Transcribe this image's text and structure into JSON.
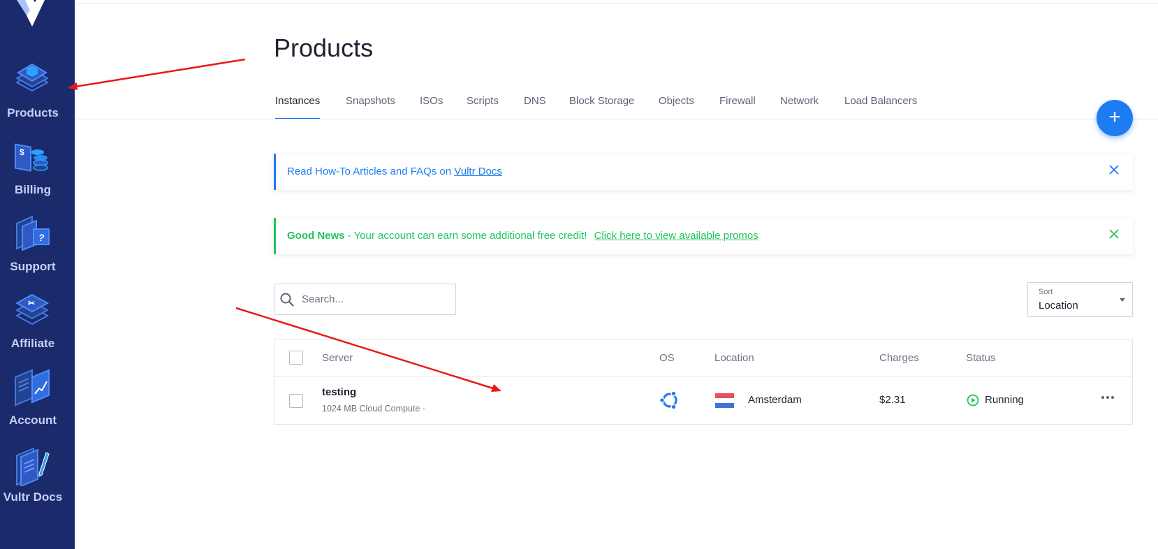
{
  "sidebar": {
    "items": [
      {
        "label": "Products",
        "icon": "products-icon"
      },
      {
        "label": "Billing",
        "icon": "billing-icon"
      },
      {
        "label": "Support",
        "icon": "support-icon"
      },
      {
        "label": "Affiliate",
        "icon": "affiliate-icon"
      },
      {
        "label": "Account",
        "icon": "account-icon"
      },
      {
        "label": "Vultr Docs",
        "icon": "docs-icon"
      }
    ]
  },
  "page": {
    "title": "Products"
  },
  "tabs": [
    {
      "label": "Instances",
      "active": true
    },
    {
      "label": "Snapshots",
      "active": false
    },
    {
      "label": "ISOs",
      "active": false
    },
    {
      "label": "Scripts",
      "active": false
    },
    {
      "label": "DNS",
      "active": false
    },
    {
      "label": "Block Storage",
      "active": false
    },
    {
      "label": "Objects",
      "active": false
    },
    {
      "label": "Firewall",
      "active": false
    },
    {
      "label": "Network",
      "active": false
    },
    {
      "label": "Load Balancers",
      "active": false
    }
  ],
  "fab": {
    "label": "+"
  },
  "alerts": {
    "docs": {
      "text": "Read How-To Articles and FAQs on ",
      "link": "Vultr Docs"
    },
    "news": {
      "bold": "Good News",
      "text": " - Your account can earn some additional free credit! ",
      "link": "Click here to view available promos"
    }
  },
  "search": {
    "placeholder": "Search..."
  },
  "sort": {
    "label": "Sort",
    "value": "Location"
  },
  "table": {
    "headers": {
      "server": "Server",
      "os": "OS",
      "location": "Location",
      "charges": "Charges",
      "status": "Status"
    },
    "rows": [
      {
        "name": "testing",
        "plan": "1024 MB Cloud Compute ·",
        "os_icon": "ubuntu-icon",
        "location": "Amsterdam",
        "flag_icon": "netherlands-flag-icon",
        "charges": "$2.31",
        "status": "Running"
      }
    ]
  },
  "colors": {
    "sidebar_bg": "#1b2a6b",
    "accent": "#1e7cf2",
    "success": "#21c55d",
    "annotation_arrow": "#e8191b"
  }
}
